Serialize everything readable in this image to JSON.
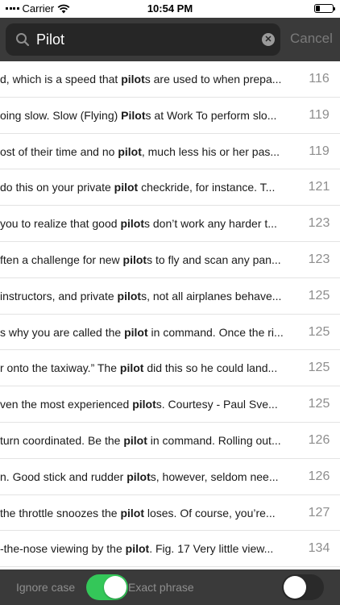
{
  "status_bar": {
    "carrier": "Carrier",
    "time": "10:54 PM",
    "battery_level": 0.25
  },
  "search": {
    "query": "Pilot",
    "cancel_label": "Cancel"
  },
  "results": [
    {
      "pre": "d, which is a speed that ",
      "match": "pilot",
      "post": "s are used to when prepa...",
      "page": "116"
    },
    {
      "pre": "oing slow. Slow (Flying) ",
      "match": "Pilot",
      "post": "s at Work To perform slo...",
      "page": "119"
    },
    {
      "pre": "ost of their time and no ",
      "match": "pilot",
      "post": ", much less his or her pas...",
      "page": "119"
    },
    {
      "pre": "do this on your private ",
      "match": "pilot",
      "post": " checkride, for instance. T...",
      "page": "121"
    },
    {
      "pre": "you to realize that good ",
      "match": "pilot",
      "post": "s don’t work any harder t...",
      "page": "123"
    },
    {
      "pre": "ften a challenge for new ",
      "match": "pilot",
      "post": "s to fly and scan any pan...",
      "page": "123"
    },
    {
      "pre": "instructors, and private ",
      "match": "pilot",
      "post": "s, not all airplanes behave...",
      "page": "125"
    },
    {
      "pre": "s why you are called the ",
      "match": "pilot",
      "post": " in command. Once the ri...",
      "page": "125"
    },
    {
      "pre": "r onto the taxiway.” The ",
      "match": "pilot",
      "post": " did this so he could land...",
      "page": "125"
    },
    {
      "pre": "ven the most experienced ",
      "match": "pilot",
      "post": "s. Courtesy - Paul Sve...",
      "page": "125"
    },
    {
      "pre": "turn coordinated. Be the ",
      "match": "pilot",
      "post": " in command. Rolling out...",
      "page": "126"
    },
    {
      "pre": "n. Good stick and rudder ",
      "match": "pilot",
      "post": "s, however, seldom nee...",
      "page": "126"
    },
    {
      "pre": "the throttle snoozes the ",
      "match": "pilot",
      "post": " loses. Of course, you’re...",
      "page": "127"
    },
    {
      "pre": "-the-nose viewing by the ",
      "match": "pilot",
      "post": ". Fig. 17 Very little view...",
      "page": "134"
    }
  ],
  "options": {
    "ignore_case": {
      "label": "Ignore case",
      "on": true
    },
    "exact_phrase": {
      "label": "Exact phrase",
      "on": false
    }
  },
  "colors": {
    "header": "#3a3a3a",
    "toggle_on": "#34c759",
    "page_number": "#8e8e8e"
  }
}
